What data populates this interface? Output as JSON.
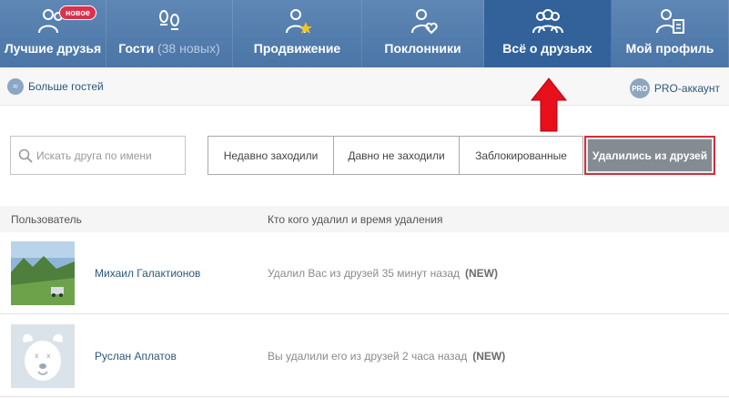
{
  "nav": {
    "tabs": [
      {
        "label": "Лучшие друзья",
        "badge": "новое"
      },
      {
        "label": "Гости",
        "sub": "(38 новых)"
      },
      {
        "label": "Продвижение"
      },
      {
        "label": "Поклонники"
      },
      {
        "label": "Всё о друзьях",
        "active": true
      },
      {
        "label": "Мой профиль"
      }
    ]
  },
  "subbar": {
    "more_guests": "Больше гостей",
    "pro_label": "PRO-аккаунт",
    "pro_icon_text": "PRO"
  },
  "search": {
    "placeholder": "Искать друга по имени"
  },
  "filters": [
    "Недавно заходили",
    "Давно не заходили",
    "Заблокированные",
    "Удалились из друзей"
  ],
  "table": {
    "headers": [
      "Пользователь",
      "Кто кого удалил и время удаления"
    ],
    "rows": [
      {
        "name": "Михаил Галактионов",
        "status": "Удалил Вас из друзей 35 минут назад",
        "flag": "(NEW)"
      },
      {
        "name": "Руслан Аплатов",
        "status": "Вы удалили его из друзей 2 часа назад",
        "flag": "(NEW)"
      }
    ]
  },
  "colors": {
    "nav": "#4a75a6",
    "nav_active": "#33629a",
    "highlight": "#d12f3c",
    "link": "#2b587a"
  }
}
